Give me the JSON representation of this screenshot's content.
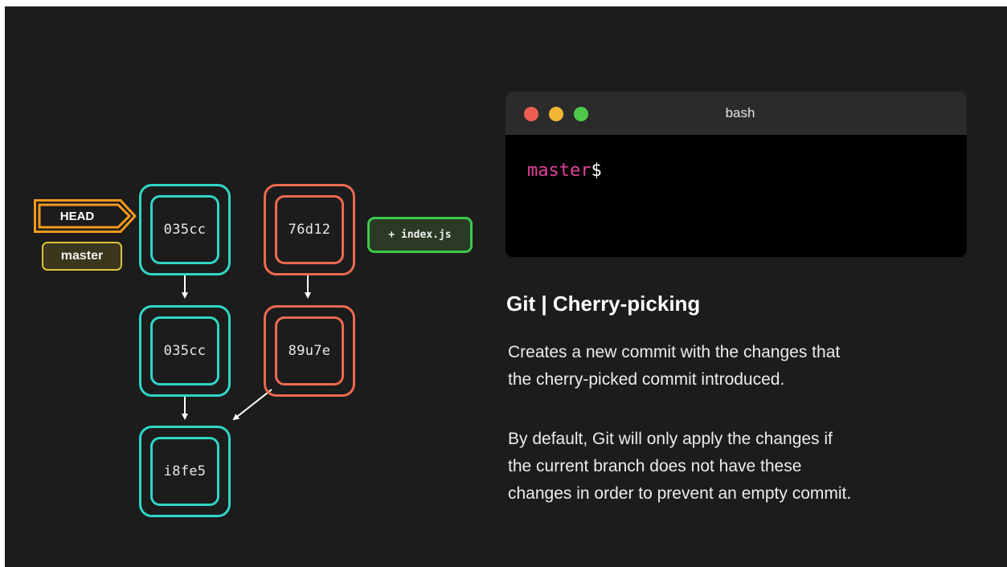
{
  "diagram": {
    "head_label": "HEAD",
    "branch_label": "master",
    "file_tag": "+ index.js",
    "commits": {
      "left_top": "035cc",
      "left_mid": "035cc",
      "bottom": "i8fe5",
      "right_top": "76d12",
      "right_mid": "89u7e"
    },
    "colors": {
      "master_branch": "#2fd6c6",
      "other_branch": "#ef6a4f",
      "head": "#f59a1e",
      "branch_badge": "#d9c43a",
      "file_tag": "#3dc94a"
    }
  },
  "terminal": {
    "title": "bash",
    "prompt_branch": "master",
    "prompt_symbol": "$",
    "prompt_color": "#e2429c"
  },
  "text": {
    "title": "Git | Cherry-picking",
    "paragraph1_lines": [
      "Creates a new commit with the changes that",
      "the cherry-picked commit introduced."
    ],
    "paragraph2_lines": [
      "By default, Git will only apply the changes if",
      "the current branch does not have these",
      "changes in order to prevent an empty commit."
    ]
  }
}
